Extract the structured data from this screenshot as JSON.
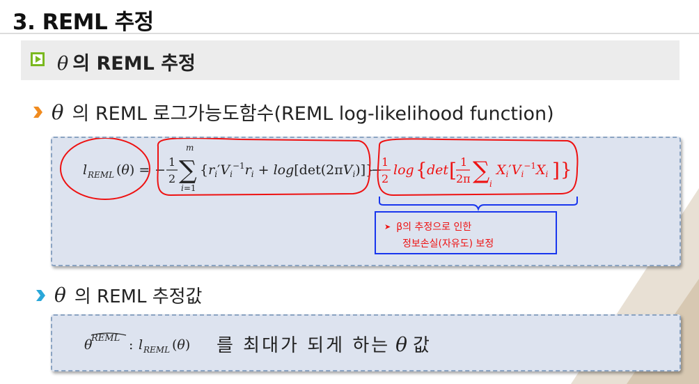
{
  "slide": {
    "title": "3. REML 추정"
  },
  "section": {
    "theta_symbol": "θ",
    "title": "의 REML 추정"
  },
  "bullet1": {
    "theta_symbol": "θ",
    "text": "의 REML 로그가능도함수(REML log-likelihood function)"
  },
  "formula1": {
    "lhs": "l_REML(θ) =",
    "term1": "−(1/2) Σ_{i=1}^{m} {r_i′ V_i⁻¹ r_i + log[det(2π V_i)]}",
    "term2": "−(1/2) log{det[(1/2π) Σ_i X_i′ V_i⁻¹ X_i]}"
  },
  "note": {
    "line1": "β의 추정으로 인한",
    "line2": "정보손실(자유도) 보정"
  },
  "bullet2": {
    "theta_symbol": "θ",
    "text": "의 REML 추정값"
  },
  "formula2": {
    "lhs": "θ^REML : l_REML(θ)",
    "text": "를 최대가 되게 하는",
    "theta_symbol": "θ",
    "suffix": "값"
  },
  "colors": {
    "section_icon": "#7ab81f",
    "bullet1_arrow": "#f08b1f",
    "bullet2_arrow": "#2aa7d9",
    "box_fill": "#dde3ef",
    "box_border": "#8aa3c2",
    "annotation_red": "#ee1111",
    "annotation_blue": "#1836ee"
  }
}
